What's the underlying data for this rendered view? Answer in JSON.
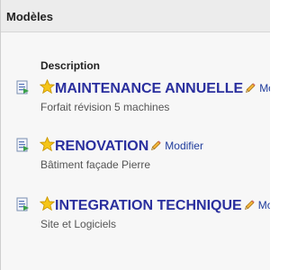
{
  "panel": {
    "title": "Modèles"
  },
  "table": {
    "column_description": "Description"
  },
  "items": [
    {
      "title": "MAINTENANCE ANNUELLE",
      "action": "Mod",
      "subtitle": "Forfait révision 5 machines"
    },
    {
      "title": "RENOVATION",
      "action": "Modifier",
      "subtitle": "Bâtiment façade Pierre"
    },
    {
      "title": "INTEGRATION TECHNIQUE",
      "action": "Mo",
      "subtitle": "Site et Logiciels"
    }
  ],
  "icons": {
    "row_icon": "document-icon",
    "favorite": "star-icon",
    "edit": "pencil-icon"
  },
  "colors": {
    "title_link": "#2a2f9e",
    "action_link": "#1f3c9c",
    "header_bg": "#ececec",
    "star": "#f5c518"
  }
}
